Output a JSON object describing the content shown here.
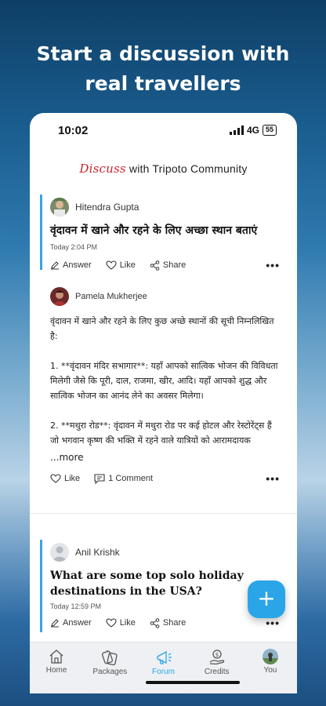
{
  "headline": {
    "line1": "Start a discussion with",
    "line2": "real travellers"
  },
  "status_bar": {
    "time": "10:02",
    "network": "4G",
    "battery": "55"
  },
  "brand": {
    "discuss": "Discuss",
    "rest": " with Tripoto Community"
  },
  "posts": [
    {
      "author": "Hitendra Gupta",
      "title": "वृंदावन में खाने और रहने के लिए अच्छा स्थान बताएं",
      "time": "Today 2:04 PM",
      "actions": {
        "answer": "Answer",
        "like": "Like",
        "share": "Share"
      },
      "answer": {
        "author": "Pamela Mukherjee",
        "paragraphs": [
          "वृंदावन में खाने और रहने के लिए कुछ अच्छे स्थानों की सूची निम्नलिखित है:",
          "1. **वृंदावन मंदिर सभागार**: यहाँ आपको सात्विक भोजन की विविधता मिलेगी जैसे कि पूरी, दाल, राजमा, खीर, आदि। यहाँ आपको शुद्ध और सात्विक भोजन का आनंद लेने का अवसर मिलेगा।",
          "2. **मथुरा रोड**: वृंदावन में मथुरा रोड पर कई होटल और रेस्टोरेंट्स हैं जो भगवान कृष्ण की भक्ति में रहने वाले यात्रियों को आरामदायक"
        ],
        "more": "...more",
        "like": "Like",
        "comments": "1 Comment"
      }
    },
    {
      "author": "Anil Krishk",
      "title": "What are some top solo holiday destinations in the USA?",
      "time": "Today 12:59 PM",
      "actions": {
        "answer": "Answer",
        "like": "Like",
        "share": "Share"
      }
    }
  ],
  "fab": {
    "label": "+"
  },
  "tabs": [
    {
      "label": "Home",
      "icon": "home-icon"
    },
    {
      "label": "Packages",
      "icon": "packages-icon"
    },
    {
      "label": "Forum",
      "icon": "megaphone-icon",
      "active": true
    },
    {
      "label": "Credits",
      "icon": "credits-icon"
    },
    {
      "label": "You",
      "icon": "avatar"
    }
  ],
  "colors": {
    "accent": "#2aa5e8",
    "brand_red": "#c9252c"
  }
}
